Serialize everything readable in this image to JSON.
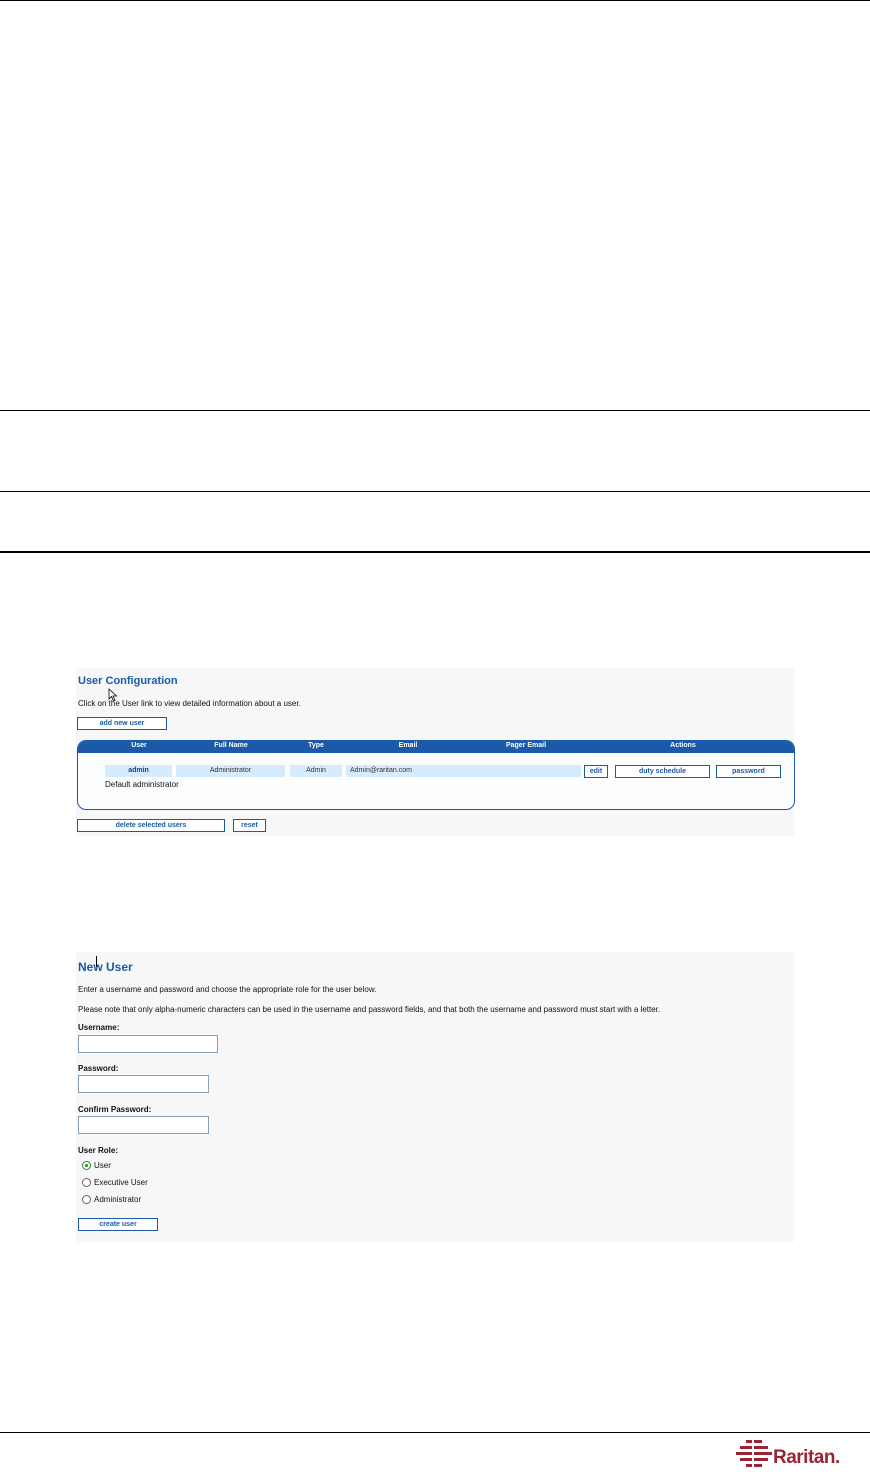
{
  "user_config": {
    "title": "User Configuration",
    "instruction": "Click on the User link to view detailed information about a user.",
    "add_button": "add new user",
    "columns": [
      "User",
      "Full Name",
      "Type",
      "Email",
      "Pager Email",
      "Actions"
    ],
    "row": {
      "user": "admin",
      "full_name": "Administrator",
      "type": "Admin",
      "email": "Admin@raritan.com",
      "pager_email": "",
      "description": "Default administrator"
    },
    "actions": [
      "edit",
      "duty schedule",
      "password"
    ],
    "delete_button": "delete selected users",
    "reset_button": "reset"
  },
  "new_user": {
    "title": "New User",
    "intro": "Enter a username and password and choose the appropriate role for the user below.",
    "note": "Please note that only alpha-numeric characters can be used in the username and password fields, and that both the username and password must start with a letter.",
    "username_label": "Username:",
    "password_label": "Password:",
    "confirm_label": "Confirm Password:",
    "role_label": "User Role:",
    "roles": [
      "User",
      "Executive User",
      "Administrator"
    ],
    "selected_role": "User",
    "create_button": "create user"
  },
  "footer": {
    "brand": "Raritan.",
    "brand_color": "#9c2236"
  }
}
